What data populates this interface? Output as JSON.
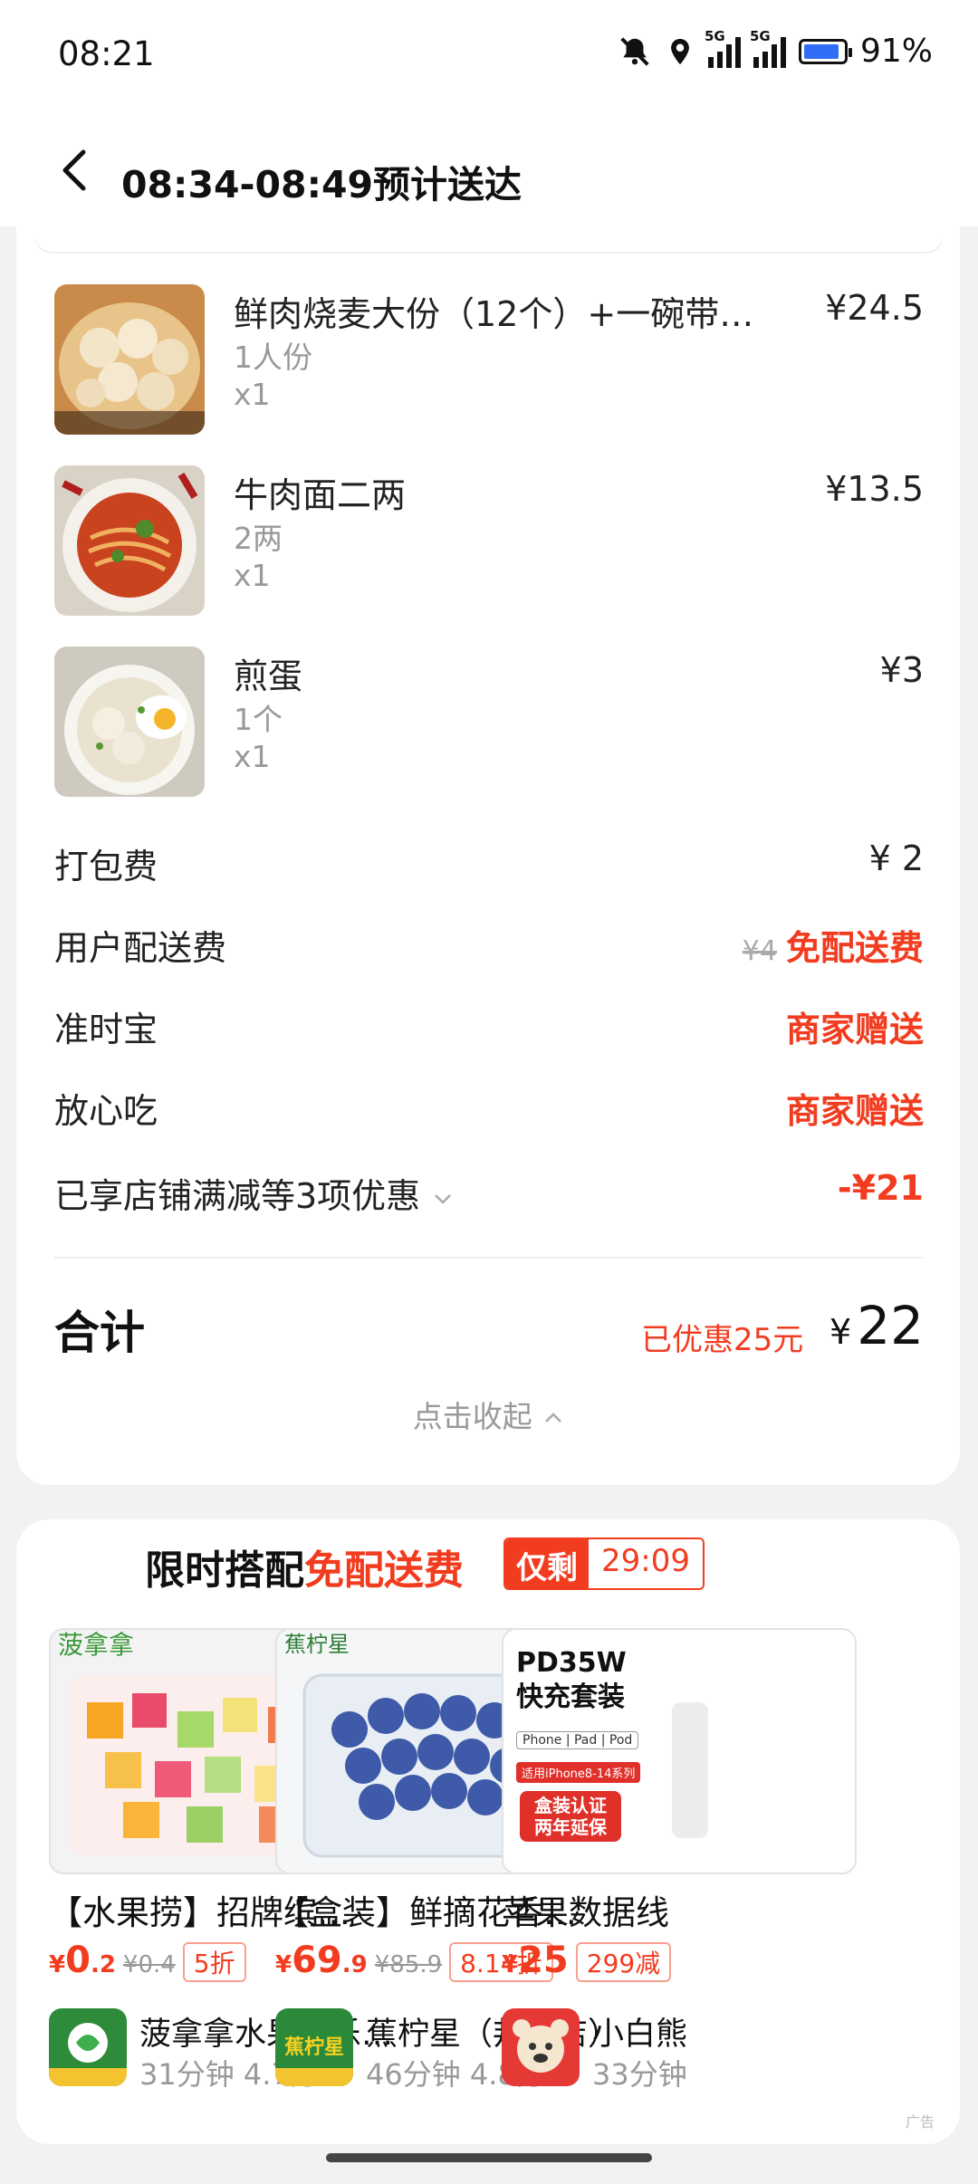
{
  "status": {
    "time": "08:21",
    "battery": "91%",
    "net1": "5G",
    "net2": "5G"
  },
  "header": {
    "title": "08:34-08:49预计送达"
  },
  "items": [
    {
      "name": "鲜肉烧麦大份（12个）+一碗带…",
      "spec": "1人份",
      "qty": "x1",
      "price": "¥24.5"
    },
    {
      "name": "牛肉面二两",
      "spec": "2两",
      "qty": "x1",
      "price": "¥13.5"
    },
    {
      "name": "煎蛋",
      "spec": "1个",
      "qty": "x1",
      "price": "¥3"
    }
  ],
  "fees": {
    "packing": {
      "label": "打包费",
      "value": "¥ 2"
    },
    "delivery": {
      "label": "用户配送费",
      "old": "¥4",
      "value": "免配送费"
    },
    "ontime": {
      "label": "准时宝",
      "value": "商家赠送"
    },
    "safe": {
      "label": "放心吃",
      "value": "商家赠送"
    },
    "discount": {
      "label": "已享店铺满减等3项优惠",
      "value": "-¥21"
    }
  },
  "total": {
    "label": "合计",
    "saved": "已优惠25元",
    "currency": "¥",
    "value": "22"
  },
  "collapse_label": "点击收起",
  "promo": {
    "title_prefix": "限时搭配",
    "title_highlight": "免配送费",
    "timer_label": "仅剩",
    "timer_value": "29:09",
    "ad_tag": "广告",
    "products": [
      {
        "name": "【水果捞】招牌缤…",
        "price_int": "0",
        "price_dec": ".2",
        "old_price": "¥0.4",
        "discount": "5折",
        "shop": "菠拿拿水果（乐…",
        "time": "31分钟",
        "rating": "4.7分",
        "brand": "菠拿拿"
      },
      {
        "name": "【盒装】鲜摘花香…",
        "price_int": "69",
        "price_dec": ".9",
        "old_price": "¥85.9",
        "discount": "8.14折",
        "shop": "蕉柠星（邦泰店）",
        "time": "46分钟",
        "rating": "4.8分",
        "brand": "蕉柠星"
      },
      {
        "name": "苹果数据线",
        "price_int": "25",
        "price_dec": "",
        "old_price": "",
        "discount": "299减",
        "shop": "小白熊",
        "time": "33分钟",
        "rating": "",
        "brand": "",
        "img_lines": [
          "PD35W",
          "快充套装",
          "Phone | Pad | Pod",
          "适用iPhone8-14系列",
          "盒装认证",
          "两年延保"
        ]
      }
    ]
  },
  "colors": {
    "accent": "#f23c20",
    "muted": "#999999"
  }
}
